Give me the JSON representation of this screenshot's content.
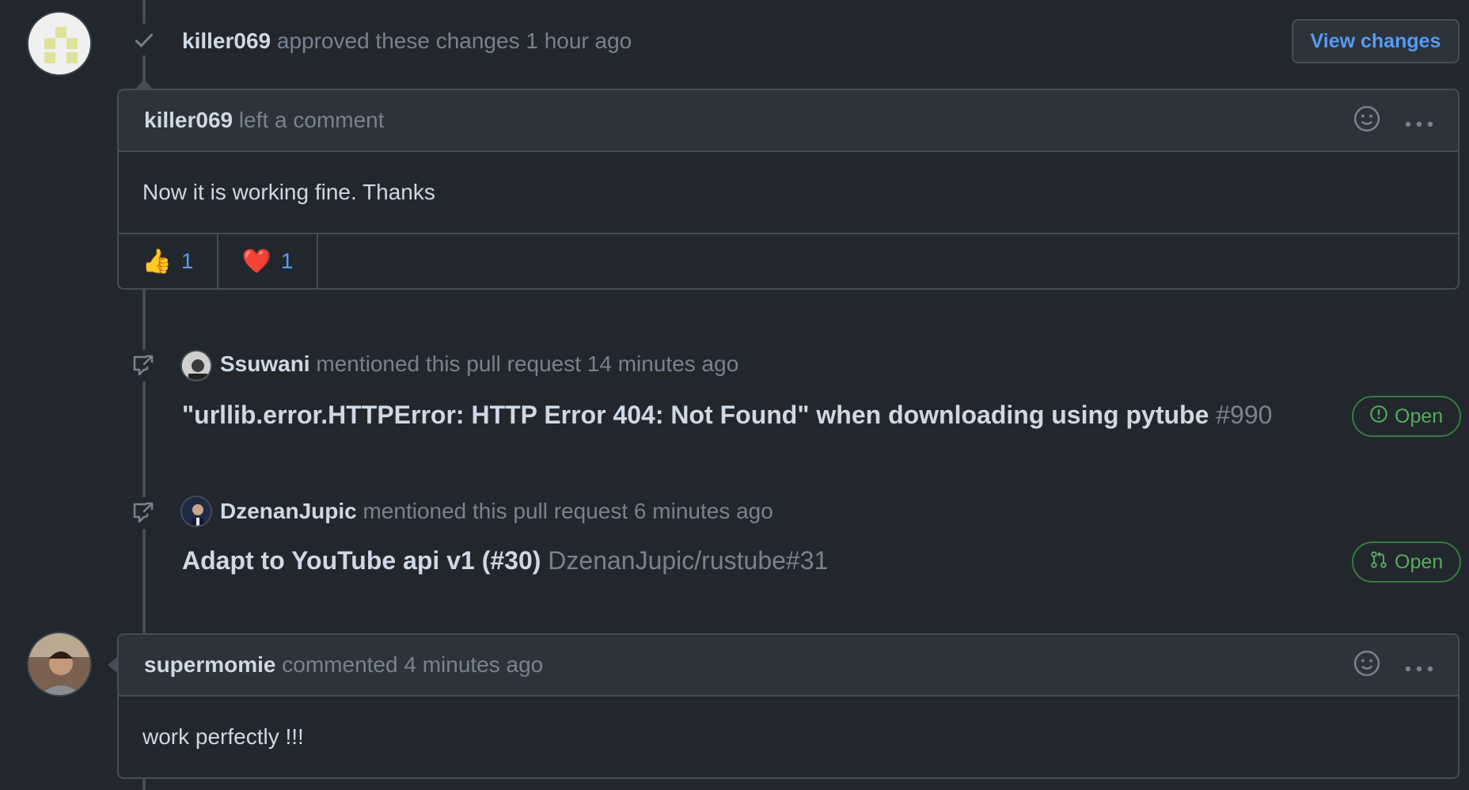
{
  "review_event": {
    "author": "killer069",
    "action": "approved these changes",
    "time": "1 hour ago",
    "button_label": "View changes",
    "icon": "check-icon"
  },
  "comment1": {
    "author": "killer069",
    "action": "left a comment",
    "body": "Now it is working fine. Thanks",
    "reactions": [
      {
        "emoji": "👍",
        "count": "1"
      },
      {
        "emoji": "❤️",
        "count": "1"
      }
    ]
  },
  "mention1": {
    "author": "Ssuwani",
    "action": "mentioned this pull request",
    "time": "14 minutes ago",
    "ref_title": "\"urllib.error.HTTPError: HTTP Error 404: Not Found\" when downloading using pytube",
    "ref_number": "#990",
    "state": "Open",
    "state_kind": "issue"
  },
  "mention2": {
    "author": "DzenanJupic",
    "action": "mentioned this pull request",
    "time": "6 minutes ago",
    "ref_title": "Adapt to YouTube api v1 (#30)",
    "ref_number": "DzenanJupic/rustube#31",
    "state": "Open",
    "state_kind": "pull-request"
  },
  "comment2": {
    "author": "supermomie",
    "action": "commented",
    "time": "4 minutes ago",
    "body": "work perfectly !!!"
  },
  "colors": {
    "background": "#22272e",
    "header_bg": "#2d333b",
    "border": "#444c56",
    "link": "#539bf5",
    "open_green": "#57ab5a"
  }
}
